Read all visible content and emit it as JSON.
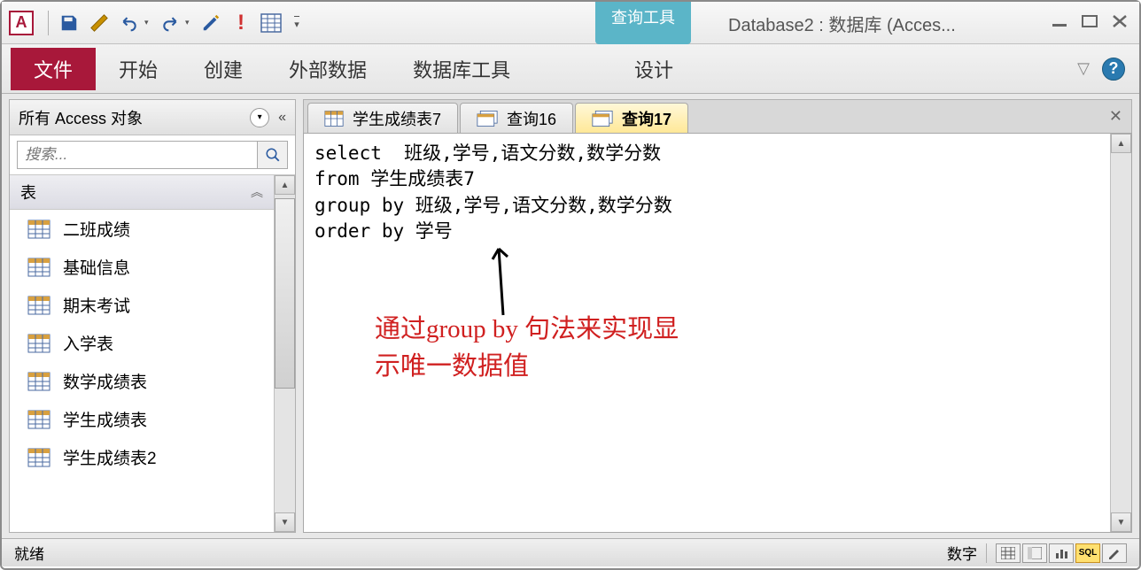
{
  "app": {
    "contextTab": "查询工具",
    "windowTitle": "Database2 : 数据库 (Acces..."
  },
  "ribbon": {
    "file": "文件",
    "home": "开始",
    "create": "创建",
    "external": "外部数据",
    "dbtools": "数据库工具",
    "design": "设计"
  },
  "nav": {
    "title": "所有 Access 对象",
    "searchPlaceholder": "搜索...",
    "group": "表",
    "items": [
      "二班成绩",
      "基础信息",
      "期末考试",
      "入学表",
      "数学成绩表",
      "学生成绩表",
      "学生成绩表2"
    ]
  },
  "tabs": {
    "t1": "学生成绩表7",
    "t2": "查询16",
    "t3": "查询17"
  },
  "sql": {
    "line1": "select  班级,学号,语文分数,数学分数",
    "line2": "from 学生成绩表7",
    "line3": "group by 班级,学号,语文分数,数学分数",
    "line4": "order by 学号"
  },
  "annotation": {
    "line1": "通过group by 句法来实现显",
    "line2": "示唯一数据值"
  },
  "status": {
    "left": "就绪",
    "right": "数字",
    "sqlLabel": "SQL"
  }
}
